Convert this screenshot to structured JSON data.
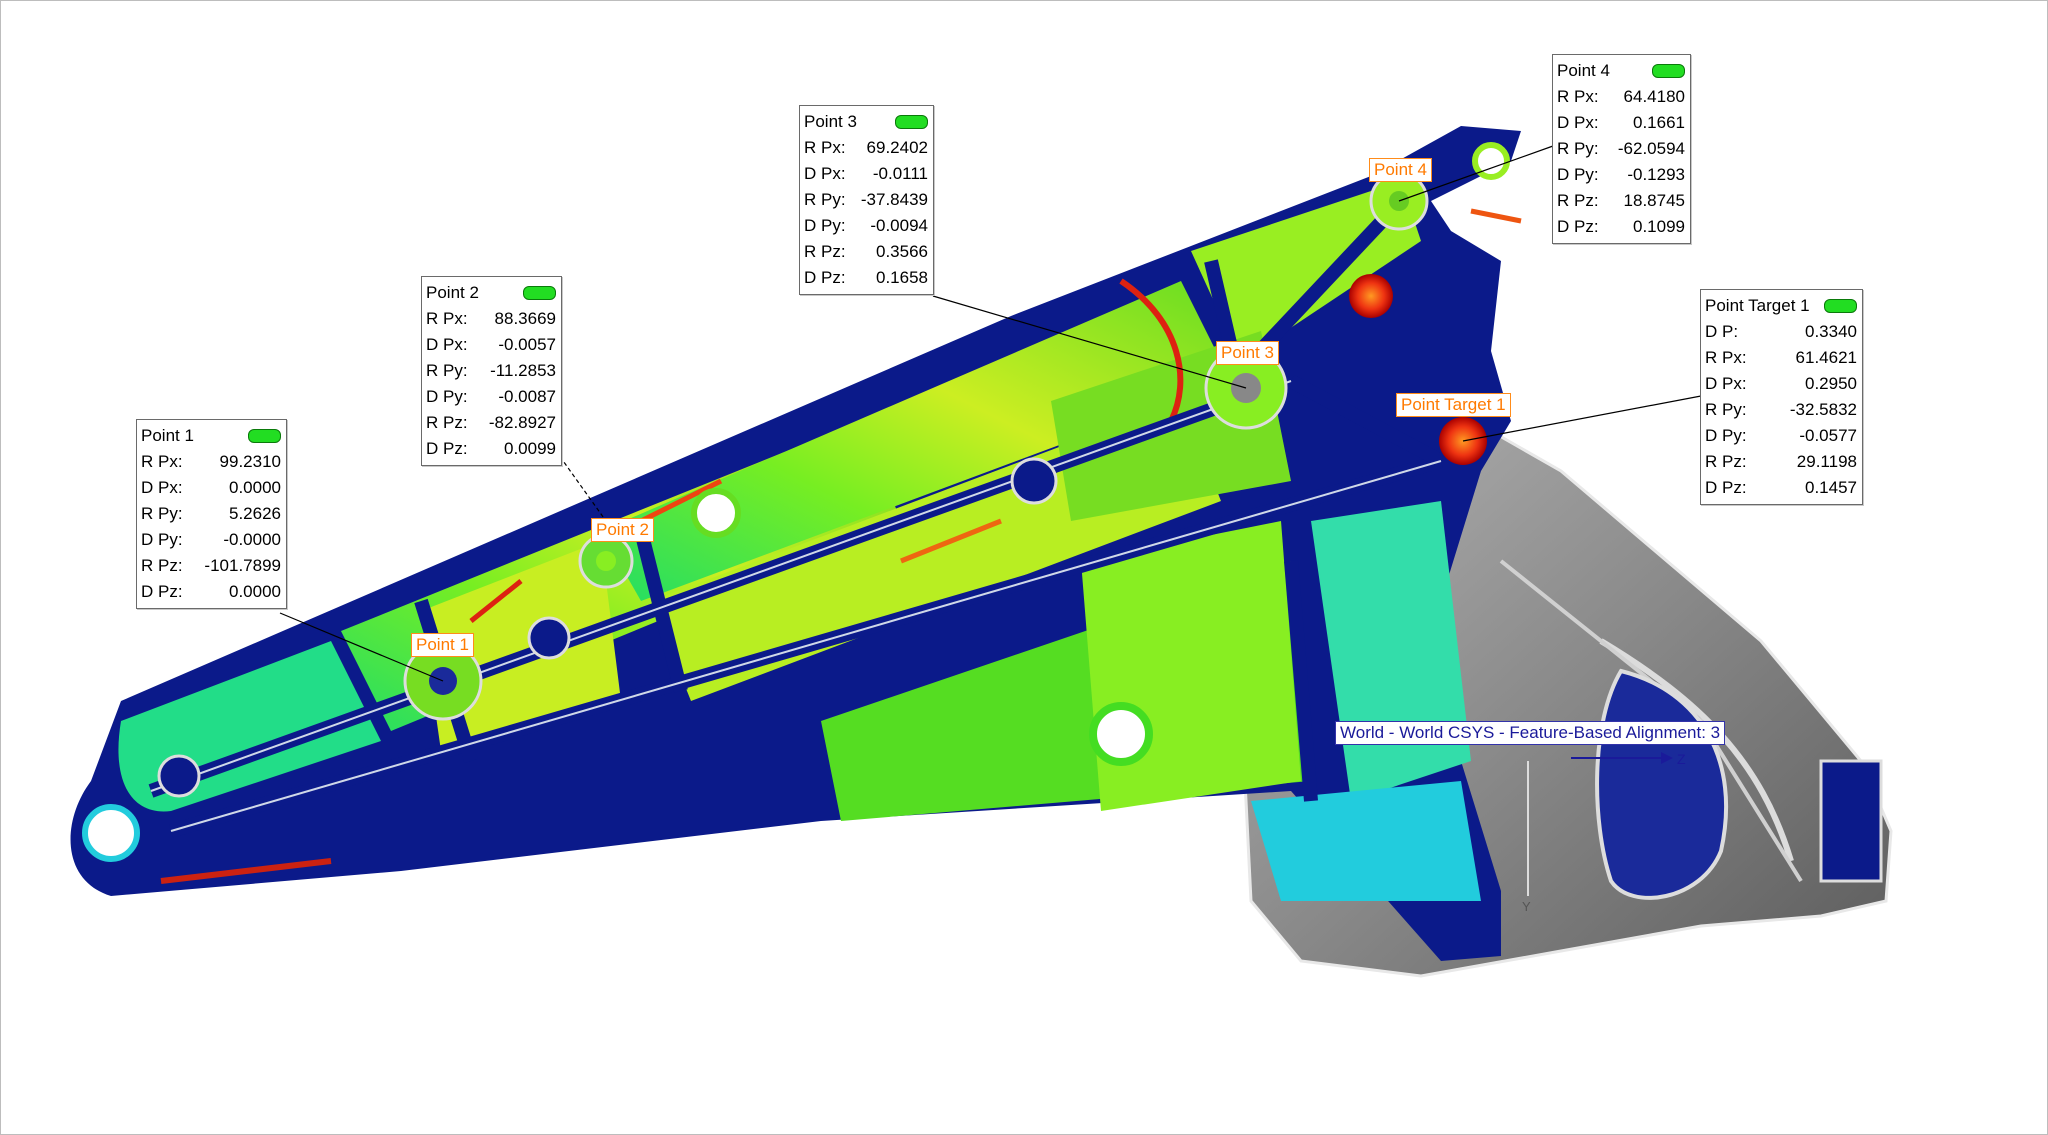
{
  "callouts": [
    {
      "title": "Point 1",
      "rows": [
        {
          "label": "R Px:",
          "value": "99.2310"
        },
        {
          "label": "D Px:",
          "value": "0.0000"
        },
        {
          "label": "R Py:",
          "value": "5.2626"
        },
        {
          "label": "D Py:",
          "value": "-0.0000"
        },
        {
          "label": "R Pz:",
          "value": "-101.7899"
        },
        {
          "label": "D Pz:",
          "value": "0.0000"
        }
      ]
    },
    {
      "title": "Point 2",
      "rows": [
        {
          "label": "R Px:",
          "value": "88.3669"
        },
        {
          "label": "D Px:",
          "value": "-0.0057"
        },
        {
          "label": "R Py:",
          "value": "-11.2853"
        },
        {
          "label": "D Py:",
          "value": "-0.0087"
        },
        {
          "label": "R Pz:",
          "value": "-82.8927"
        },
        {
          "label": "D Pz:",
          "value": "0.0099"
        }
      ]
    },
    {
      "title": "Point 3",
      "rows": [
        {
          "label": "R Px:",
          "value": "69.2402"
        },
        {
          "label": "D Px:",
          "value": "-0.0111"
        },
        {
          "label": "R Py:",
          "value": "-37.8439"
        },
        {
          "label": "D Py:",
          "value": "-0.0094"
        },
        {
          "label": "R Pz:",
          "value": "0.3566"
        },
        {
          "label": "D Pz:",
          "value": "0.1658"
        }
      ]
    },
    {
      "title": "Point 4",
      "rows": [
        {
          "label": "R Px:",
          "value": "64.4180"
        },
        {
          "label": "D Px:",
          "value": "0.1661"
        },
        {
          "label": "R Py:",
          "value": "-62.0594"
        },
        {
          "label": "D Py:",
          "value": "-0.1293"
        },
        {
          "label": "R Pz:",
          "value": "18.8745"
        },
        {
          "label": "D Pz:",
          "value": "0.1099"
        }
      ]
    },
    {
      "title": "Point Target 1",
      "rows": [
        {
          "label": "D P:",
          "value": "0.3340"
        },
        {
          "label": "R Px:",
          "value": "61.4621"
        },
        {
          "label": "D Px:",
          "value": "0.2950"
        },
        {
          "label": "R Py:",
          "value": "-32.5832"
        },
        {
          "label": "D Py:",
          "value": "-0.0577"
        },
        {
          "label": "R Pz:",
          "value": "29.1198"
        },
        {
          "label": "D Pz:",
          "value": "0.1457"
        }
      ]
    }
  ],
  "point_labels": [
    "Point 1",
    "Point 2",
    "Point 3",
    "Point 4",
    "Point Target 1"
  ],
  "csys_label": "World - World CSYS - Feature-Based Alignment: 3",
  "axis_labels": {
    "z": "Z",
    "y": "Y"
  },
  "colors": {
    "status_ok": "#22dd22",
    "point_label": "#ff7a00",
    "csys_label": "#1a1a9a",
    "map_blue": "#0b1a8a",
    "map_green": "#33dd22",
    "map_yellow": "#e6ee22",
    "map_red": "#e01a1a",
    "part_gray": "#8c8c8c"
  }
}
